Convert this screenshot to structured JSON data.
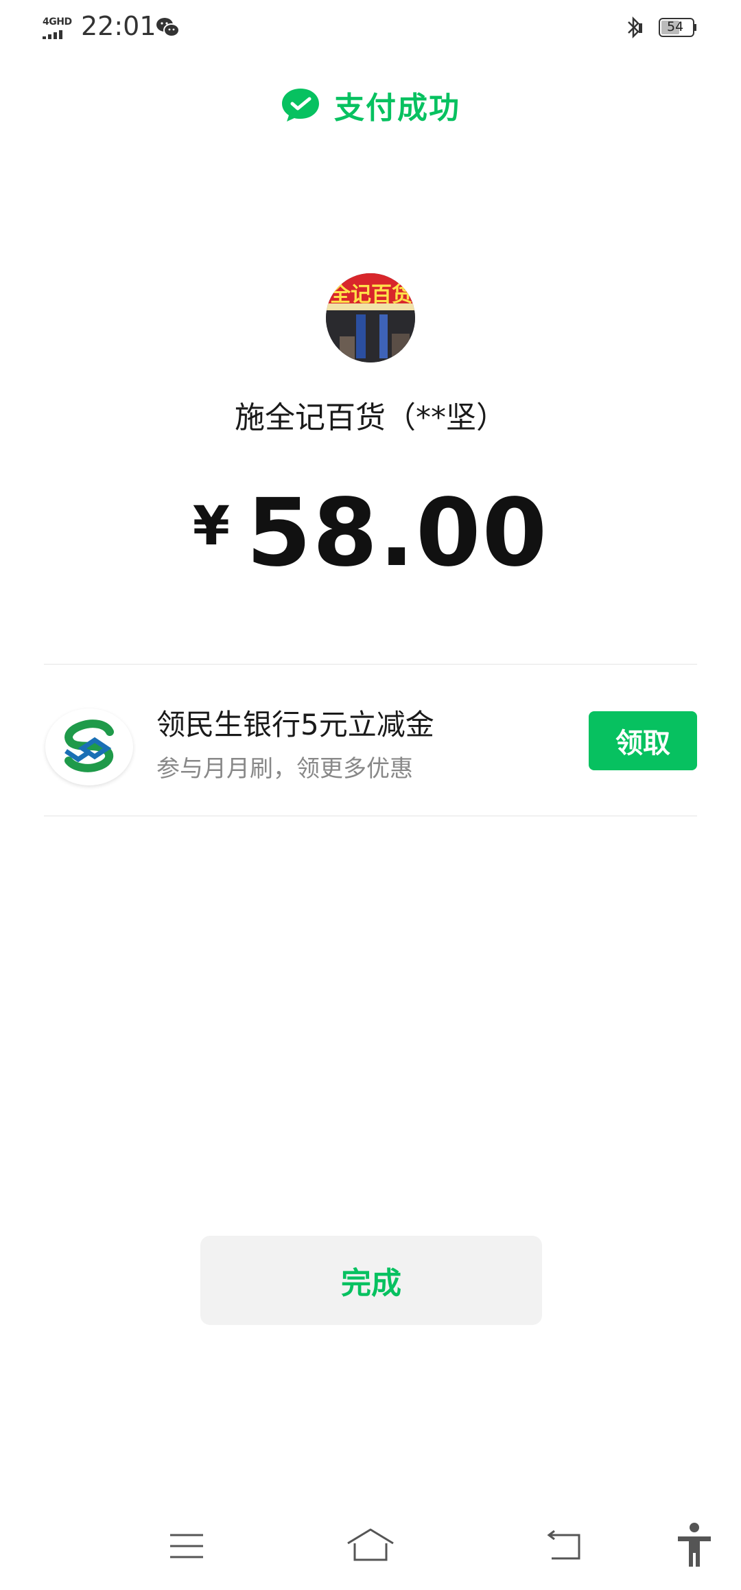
{
  "status_bar": {
    "network": "4GHD",
    "time": "22:01",
    "battery": "54"
  },
  "header": {
    "title": "支付成功"
  },
  "merchant": {
    "name": "施全记百货（**坚）",
    "avatar_text": "全记百货"
  },
  "payment": {
    "currency": "¥",
    "amount": "58.00"
  },
  "promo": {
    "title": "领民生银行5元立减金",
    "subtitle": "参与月月刷，领更多优惠",
    "button": "领取"
  },
  "done_button": "完成",
  "nav_bar": {
    "icons": [
      "menu-icon",
      "home-icon",
      "back-icon",
      "accessibility-icon"
    ]
  },
  "colors": {
    "accent": "#07c160",
    "background": "#ffffff"
  }
}
